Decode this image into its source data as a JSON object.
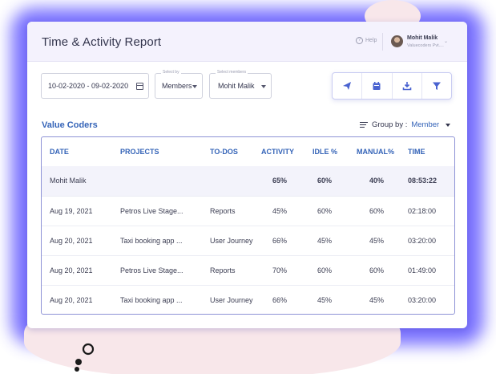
{
  "header": {
    "title": "Time & Activity Report",
    "help_label": "Help",
    "user": {
      "name": "Mohit Malik",
      "org": "Valuecoders Pvt...."
    }
  },
  "filters": {
    "date_range": "10-02-2020 - 09-02-2020",
    "select_by_label": "Select by",
    "select_by_value": "Members",
    "select_members_label": "Select members",
    "select_members_value": "Mohit Malik",
    "toolbar_icons": [
      "send-icon",
      "calendar-icon",
      "download-icon",
      "filter-icon"
    ]
  },
  "section": {
    "title": "Value Coders",
    "group_by_label": "Group by :",
    "group_by_value": "Member"
  },
  "table": {
    "columns": [
      "DATE",
      "PROJECTS",
      "TO-DOS",
      "ACTIVITY",
      "IDLE %",
      "MANUAL%",
      "TIME"
    ],
    "summary": {
      "name": "Mohit Malik",
      "activity": "65%",
      "idle": "60%",
      "manual": "40%",
      "time": "08:53:22"
    },
    "rows": [
      {
        "date": "Aug 19, 2021",
        "project": "Petros Live Stage...",
        "todo": "Reports",
        "activity": "45%",
        "idle": "60%",
        "manual": "60%",
        "time": "02:18:00"
      },
      {
        "date": "Aug 20, 2021",
        "project": "Taxi booking app ...",
        "todo": "User Journey",
        "activity": "66%",
        "idle": "45%",
        "manual": "45%",
        "time": "03:20:00"
      },
      {
        "date": "Aug 20, 2021",
        "project": "Petros Live Stage...",
        "todo": "Reports",
        "activity": "70%",
        "idle": "60%",
        "manual": "60%",
        "time": "01:49:00"
      },
      {
        "date": "Aug 20, 2021",
        "project": "Taxi booking app ...",
        "todo": "User Journey",
        "activity": "66%",
        "idle": "45%",
        "manual": "45%",
        "time": "03:20:00"
      }
    ]
  },
  "colors": {
    "accent": "#3564b8",
    "glow": "#6c63ff",
    "header_bg": "#f4f2fd"
  }
}
